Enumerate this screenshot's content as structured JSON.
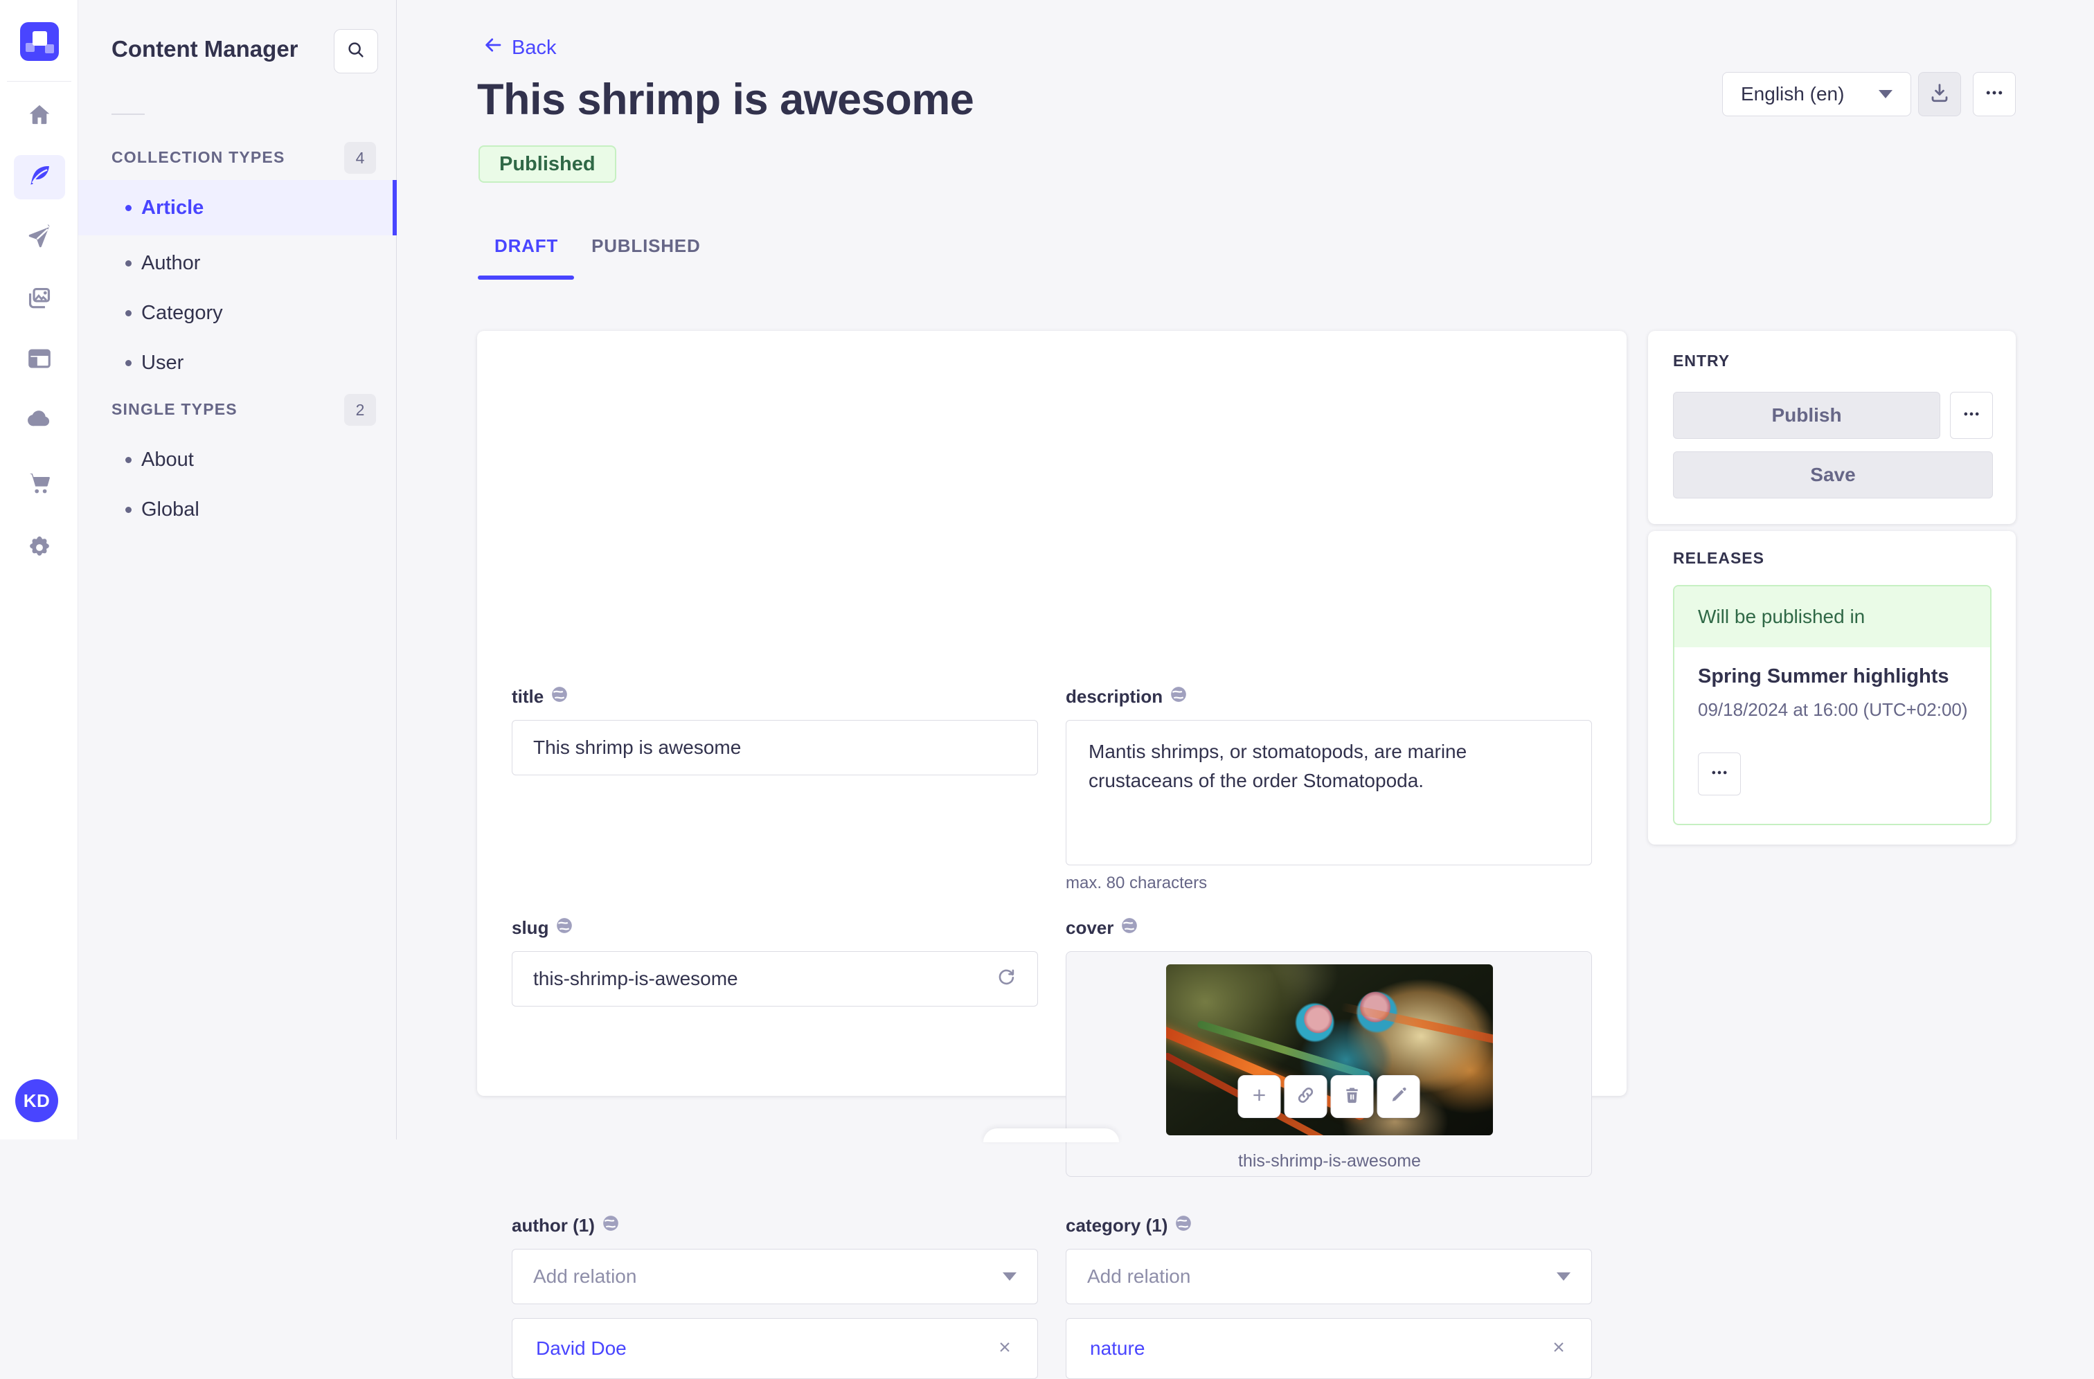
{
  "sidebar": {
    "title": "Content Manager",
    "sections": [
      {
        "label": "COLLECTION TYPES",
        "count": "4",
        "items": [
          {
            "label": "Article",
            "active": true
          },
          {
            "label": "Author"
          },
          {
            "label": "Category"
          },
          {
            "label": "User"
          }
        ]
      },
      {
        "label": "SINGLE TYPES",
        "count": "2",
        "items": [
          {
            "label": "About"
          },
          {
            "label": "Global"
          }
        ]
      }
    ]
  },
  "header": {
    "back_label": "Back",
    "title": "This shrimp is awesome",
    "status": "Published",
    "locale": "English (en)",
    "tabs": [
      {
        "label": "DRAFT",
        "active": true
      },
      {
        "label": "PUBLISHED"
      }
    ]
  },
  "form": {
    "title": {
      "label": "title",
      "value": "This shrimp is awesome"
    },
    "description": {
      "label": "description",
      "value": "Mantis shrimps, or stomatopods, are marine crustaceans of the order Stomatopoda.",
      "helper": "max. 80 characters"
    },
    "slug": {
      "label": "slug",
      "value": "this-shrimp-is-awesome"
    },
    "cover": {
      "label": "cover",
      "filename": "this-shrimp-is-awesome"
    },
    "author": {
      "label": "author (1)",
      "placeholder": "Add relation",
      "relation": "David Doe"
    },
    "category": {
      "label": "category (1)",
      "placeholder": "Add relation",
      "relation": "nature"
    }
  },
  "entry_panel": {
    "heading": "ENTRY",
    "publish_label": "Publish",
    "save_label": "Save"
  },
  "releases_panel": {
    "heading": "RELEASES",
    "status": "Will be published in",
    "release_title": "Spring Summer highlights",
    "release_date": "09/18/2024 at 16:00 (UTC+02:00)"
  },
  "user": {
    "initials": "KD"
  },
  "colors": {
    "primary": "#4945FF",
    "success_text": "#2F6846",
    "success_bg": "#EAFBE7",
    "success_border": "#C6F0C2"
  }
}
